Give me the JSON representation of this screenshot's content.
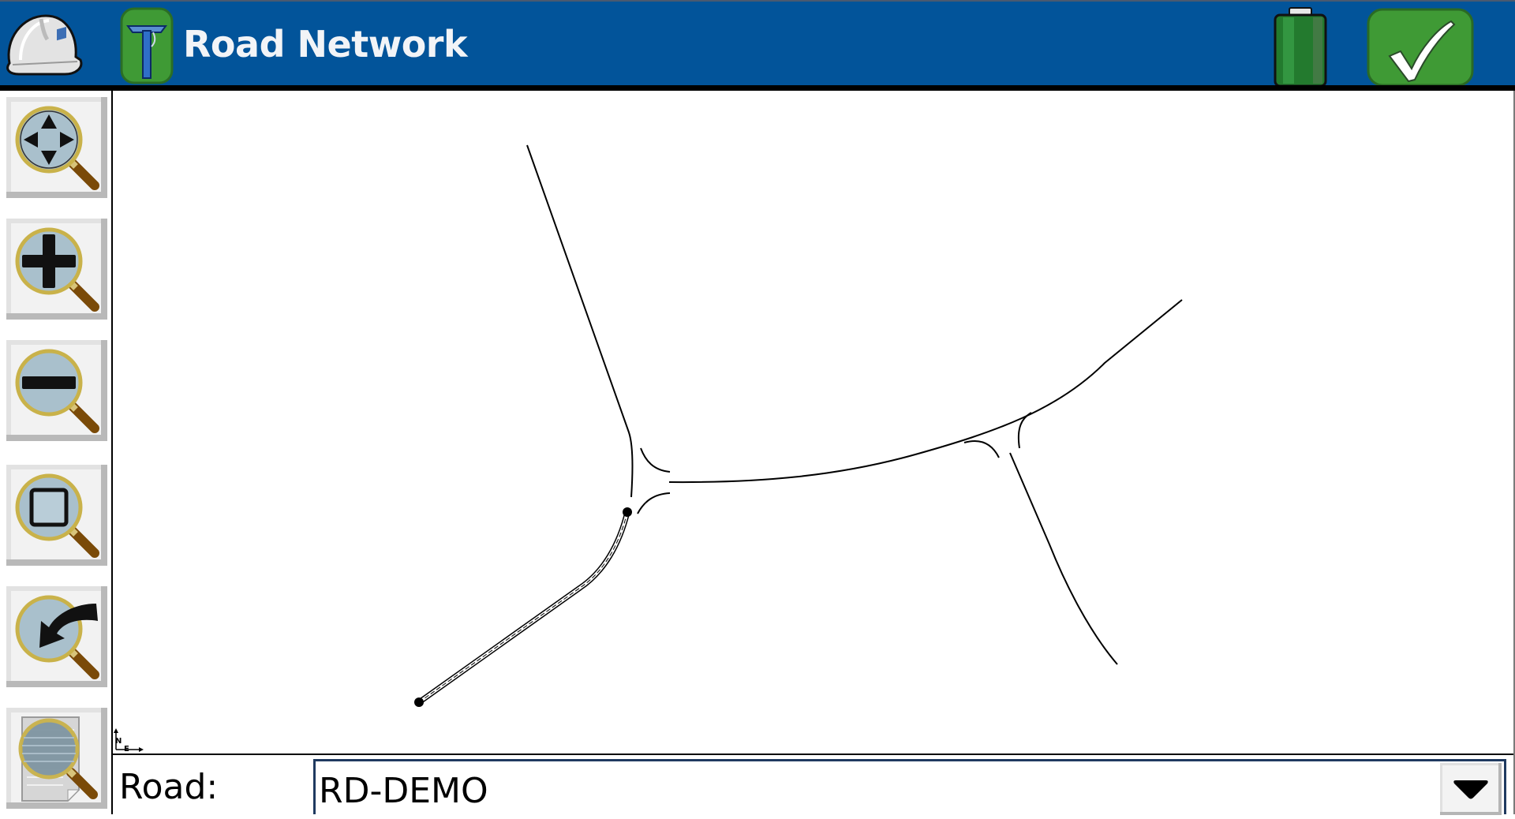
{
  "header": {
    "title": "Road Network",
    "colors": {
      "bar": "#02549a",
      "accent_green": "#3f9a35"
    },
    "icons": {
      "app_menu": "hard-hat-icon",
      "instrument": "gps-receiver-icon",
      "battery": "battery-icon",
      "accept": "checkmark-icon"
    }
  },
  "toolbar": {
    "buttons": [
      {
        "name": "pan",
        "icon": "pan-magnifier-icon"
      },
      {
        "name": "zoom-in",
        "icon": "zoom-in-icon"
      },
      {
        "name": "zoom-out",
        "icon": "zoom-out-icon"
      },
      {
        "name": "zoom-extents",
        "icon": "zoom-extents-icon"
      },
      {
        "name": "zoom-previous",
        "icon": "zoom-previous-icon"
      },
      {
        "name": "zoom-list",
        "icon": "zoom-list-icon"
      }
    ]
  },
  "map": {
    "north_label": "N",
    "east_label": "E",
    "selected_road": "RD-DEMO"
  },
  "footer": {
    "road_label": "Road:",
    "road_value": "RD-DEMO"
  }
}
